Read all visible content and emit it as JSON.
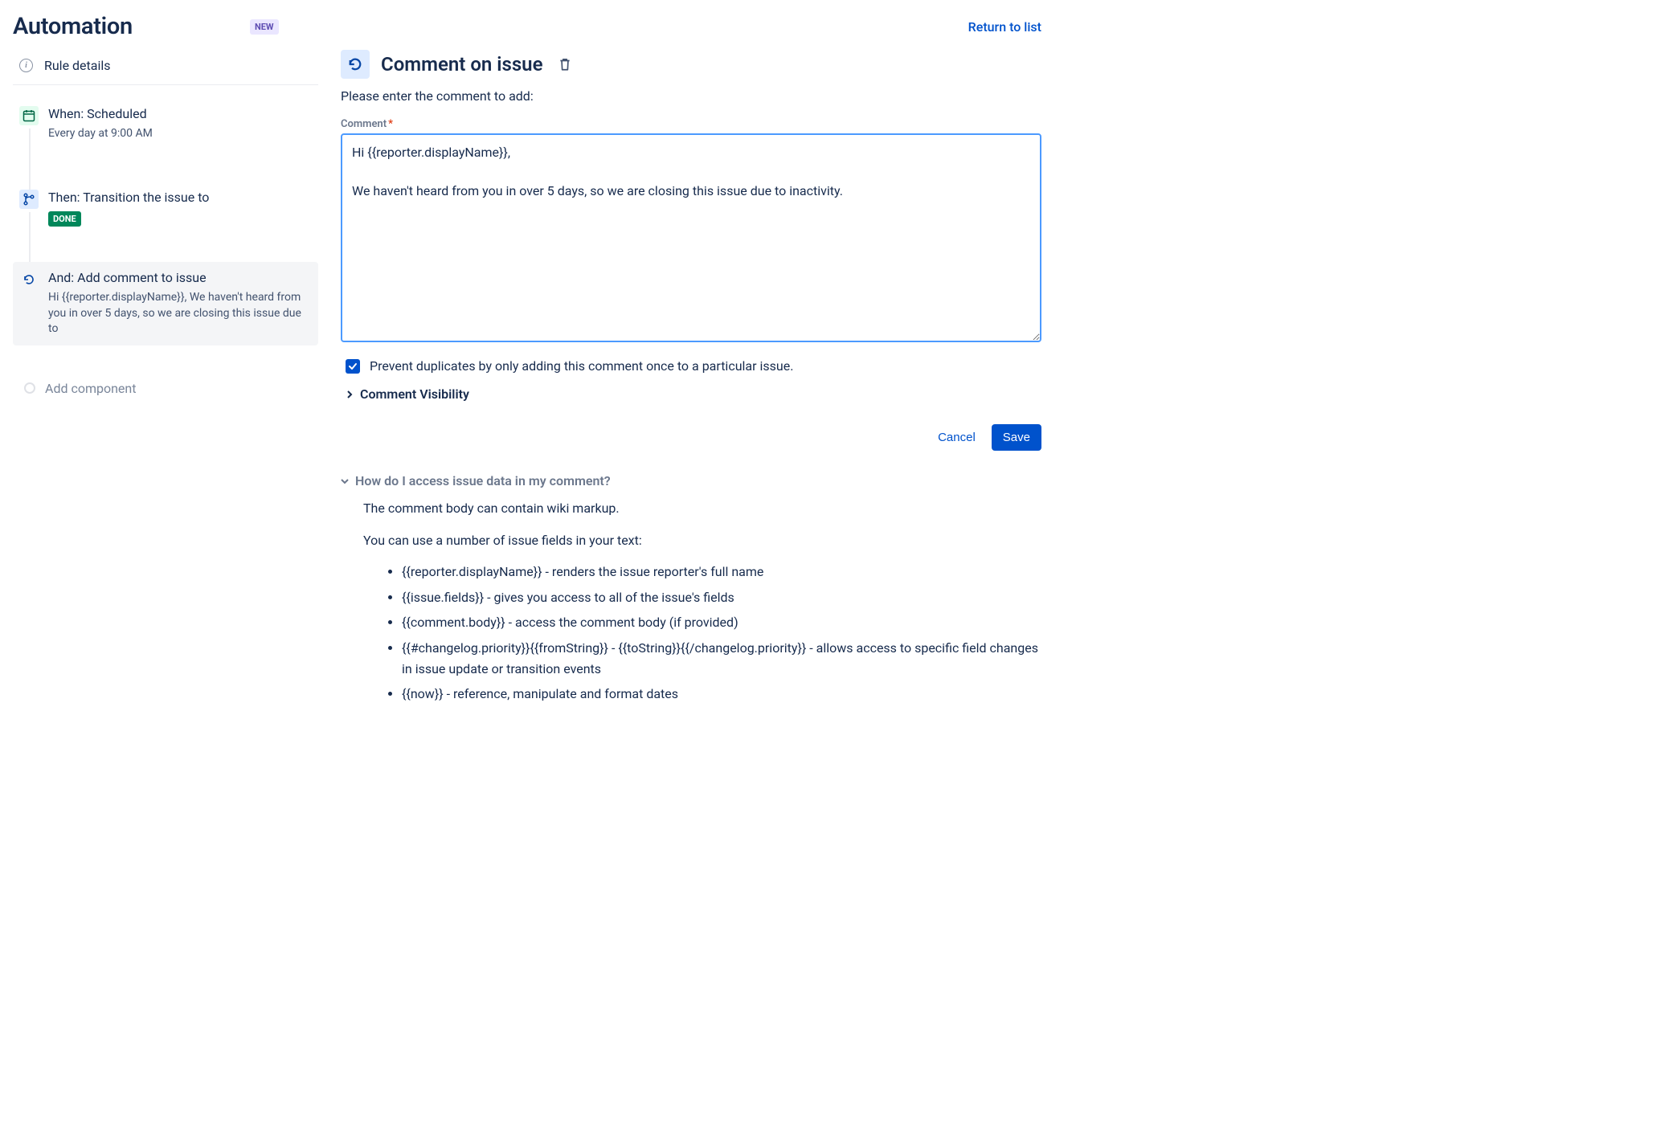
{
  "header": {
    "title": "Automation",
    "new_badge": "NEW",
    "return_link": "Return to list"
  },
  "sidebar": {
    "rule_details_label": "Rule details",
    "steps": [
      {
        "title": "When: Scheduled",
        "subtitle": "Every day at 9:00 AM",
        "icon": "calendar-icon",
        "icon_bg": "green"
      },
      {
        "title": "Then: Transition the issue to",
        "badge": "DONE",
        "icon": "branch-icon",
        "icon_bg": "blue"
      },
      {
        "title": "And: Add comment to issue",
        "subtitle": "Hi {{reporter.displayName}}, We haven't heard from you in over 5 days, so we are closing this issue due to",
        "icon": "refresh-icon",
        "icon_bg": "white",
        "selected": true
      }
    ],
    "add_component": "Add component"
  },
  "main": {
    "title": "Comment on issue",
    "instruction": "Please enter the comment to add:",
    "comment_label": "Comment",
    "comment_value": "Hi {{reporter.displayName}},\n\nWe haven't heard from you in over 5 days, so we are closing this issue due to inactivity.",
    "prevent_duplicates_label": "Prevent duplicates by only adding this comment once to a particular issue.",
    "prevent_duplicates_checked": true,
    "visibility_label": "Comment Visibility",
    "cancel_label": "Cancel",
    "save_label": "Save",
    "help": {
      "toggle": "How do I access issue data in my comment?",
      "intro1": "The comment body can contain wiki markup.",
      "intro2": "You can use a number of issue fields in your text:",
      "items": [
        "{{reporter.displayName}} - renders the issue reporter's full name",
        "{{issue.fields}} - gives you access to all of the issue's fields",
        "{{comment.body}} - access the comment body (if provided)",
        "{{#changelog.priority}}{{fromString}} - {{toString}}{{/changelog.priority}} - allows access to specific field changes in issue update or transition events",
        "{{now}} - reference, manipulate and format dates"
      ]
    }
  }
}
